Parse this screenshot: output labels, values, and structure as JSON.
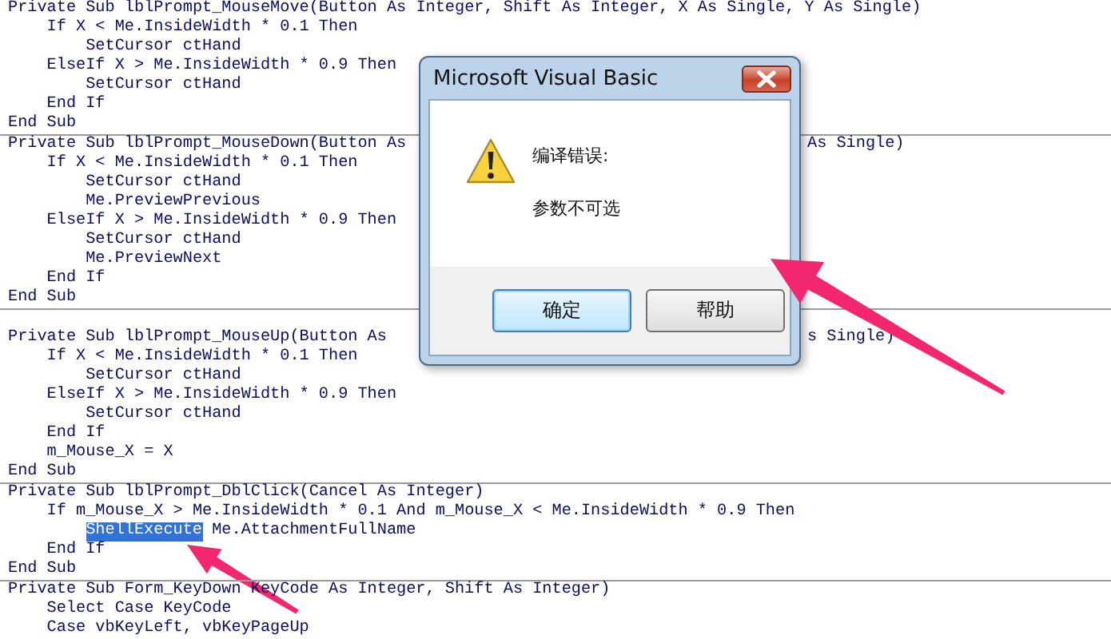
{
  "code_editor": {
    "procedures": [
      {
        "lines": [
          {
            "kind": "code",
            "text": "Private Sub lblPrompt_MouseMove(Button As Integer, Shift As Integer, X As Single, Y As Single)"
          },
          {
            "kind": "code",
            "text": "    If X < Me.InsideWidth * 0.1 Then"
          },
          {
            "kind": "code",
            "text": "        SetCursor ctHand"
          },
          {
            "kind": "code",
            "text": "    ElseIf X > Me.InsideWidth * 0.9 Then"
          },
          {
            "kind": "code",
            "text": "        SetCursor ctHand"
          },
          {
            "kind": "code",
            "text": "    End If"
          },
          {
            "kind": "code",
            "text": "End Sub"
          }
        ]
      },
      {
        "lines": [
          {
            "kind": "code",
            "text": "Private Sub lblPrompt_MouseDown(Button As",
            "tail": "As Single)"
          },
          {
            "kind": "code",
            "text": "    If X < Me.InsideWidth * 0.1 Then"
          },
          {
            "kind": "code",
            "text": "        SetCursor ctHand"
          },
          {
            "kind": "code",
            "text": "        Me.PreviewPrevious"
          },
          {
            "kind": "code",
            "text": "    ElseIf X > Me.InsideWidth * 0.9 Then"
          },
          {
            "kind": "code",
            "text": "        SetCursor ctHand"
          },
          {
            "kind": "code",
            "text": "        Me.PreviewNext"
          },
          {
            "kind": "code",
            "text": "    End If"
          },
          {
            "kind": "code",
            "text": "End Sub"
          }
        ]
      },
      {
        "lines": [
          {
            "kind": "blank"
          },
          {
            "kind": "code",
            "text": "Private Sub lblPrompt_MouseUp(Button As",
            "tail": "s Single)"
          },
          {
            "kind": "code",
            "text": "    If X < Me.InsideWidth * 0.1 Then"
          },
          {
            "kind": "code",
            "text": "        SetCursor ctHand"
          },
          {
            "kind": "code",
            "text": "    ElseIf X > Me.InsideWidth * 0.9 Then"
          },
          {
            "kind": "code",
            "text": "        SetCursor ctHand"
          },
          {
            "kind": "code",
            "text": "    End If"
          },
          {
            "kind": "code",
            "text": "    m_Mouse_X = X"
          },
          {
            "kind": "code",
            "text": "End Sub"
          }
        ]
      },
      {
        "lines": [
          {
            "kind": "code",
            "text": "Private Sub lblPrompt_DblClick(Cancel As Integer)"
          },
          {
            "kind": "code",
            "text": "    If m_Mouse_X > Me.InsideWidth * 0.1 And m_Mouse_X < Me.InsideWidth * 0.9 Then"
          },
          {
            "kind": "segmented",
            "segments": [
              {
                "text": "ShellExecute",
                "selected": true
              },
              {
                "text": " Me.AttachmentFullName",
                "selected": false
              }
            ]
          },
          {
            "kind": "code",
            "text": "    End If"
          },
          {
            "kind": "code",
            "text": "End Sub"
          }
        ]
      },
      {
        "lines": [
          {
            "kind": "code",
            "text": "Private Sub Form_KeyDown",
            "rest": "KeyCode As Integer, Shift As Integer)"
          },
          {
            "kind": "code",
            "text": "    Select Case KeyCode"
          },
          {
            "kind": "code",
            "text": "    Case vbKeyLeft, vbKeyPageUp"
          }
        ]
      }
    ]
  },
  "dialog": {
    "title": "Microsoft Visual Basic",
    "heading": "编译错误:",
    "message": "参数不可选",
    "buttons": [
      {
        "label": "确定",
        "selected": true
      },
      {
        "label": "帮助",
        "selected": false
      }
    ]
  },
  "annotations": [
    {
      "kind": "arrow"
    },
    {
      "kind": "arrow"
    }
  ]
}
